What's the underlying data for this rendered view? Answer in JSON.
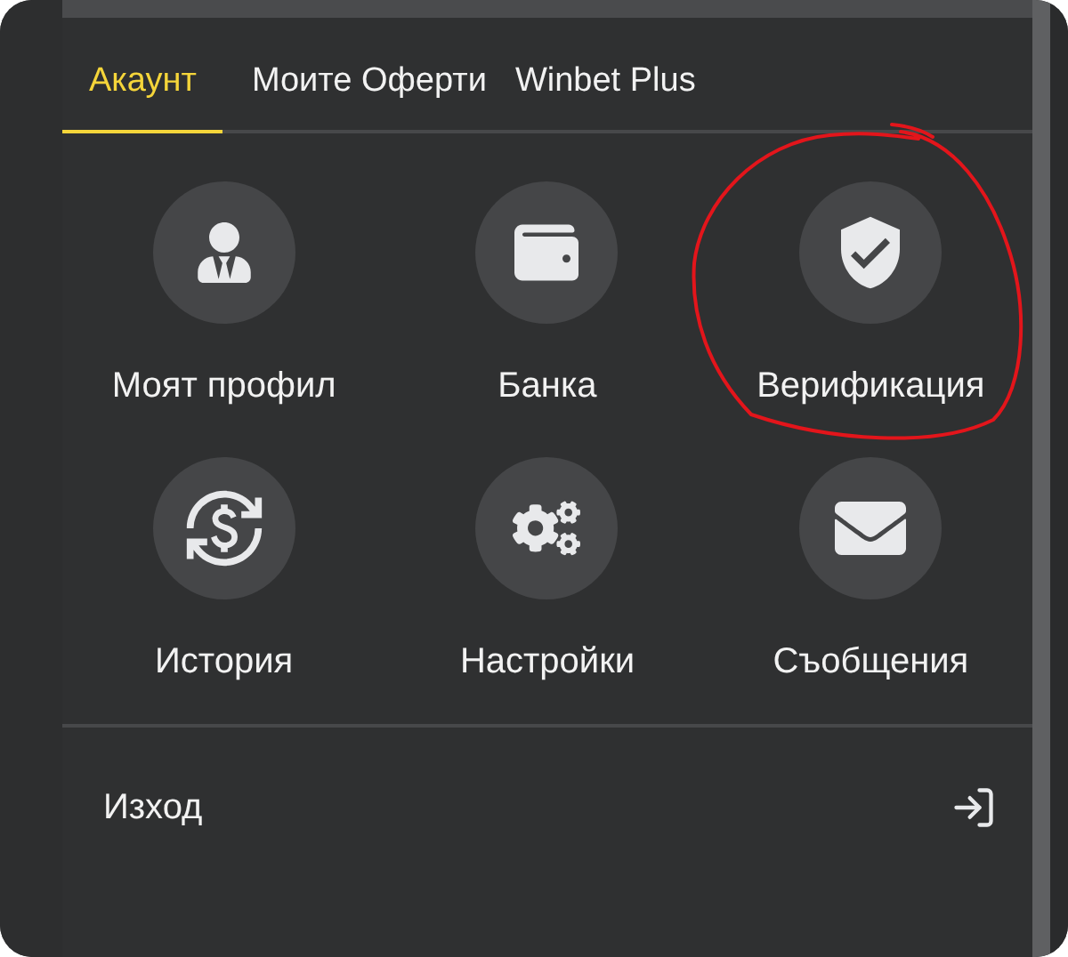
{
  "tabs": [
    {
      "label": "Акаунт",
      "selected": true
    },
    {
      "label": "Моите Оферти",
      "selected": false
    },
    {
      "label": "Winbet Plus",
      "selected": false
    }
  ],
  "menu_items": [
    {
      "label": "Моят профил",
      "circled": false
    },
    {
      "label": "Банка",
      "circled": false
    },
    {
      "label": "Верификация",
      "circled": true
    },
    {
      "label": "История",
      "circled": false
    },
    {
      "label": "Настройки",
      "circled": false
    },
    {
      "label": "Съобщения",
      "circled": false
    }
  ],
  "logout": {
    "label": "Изход"
  }
}
